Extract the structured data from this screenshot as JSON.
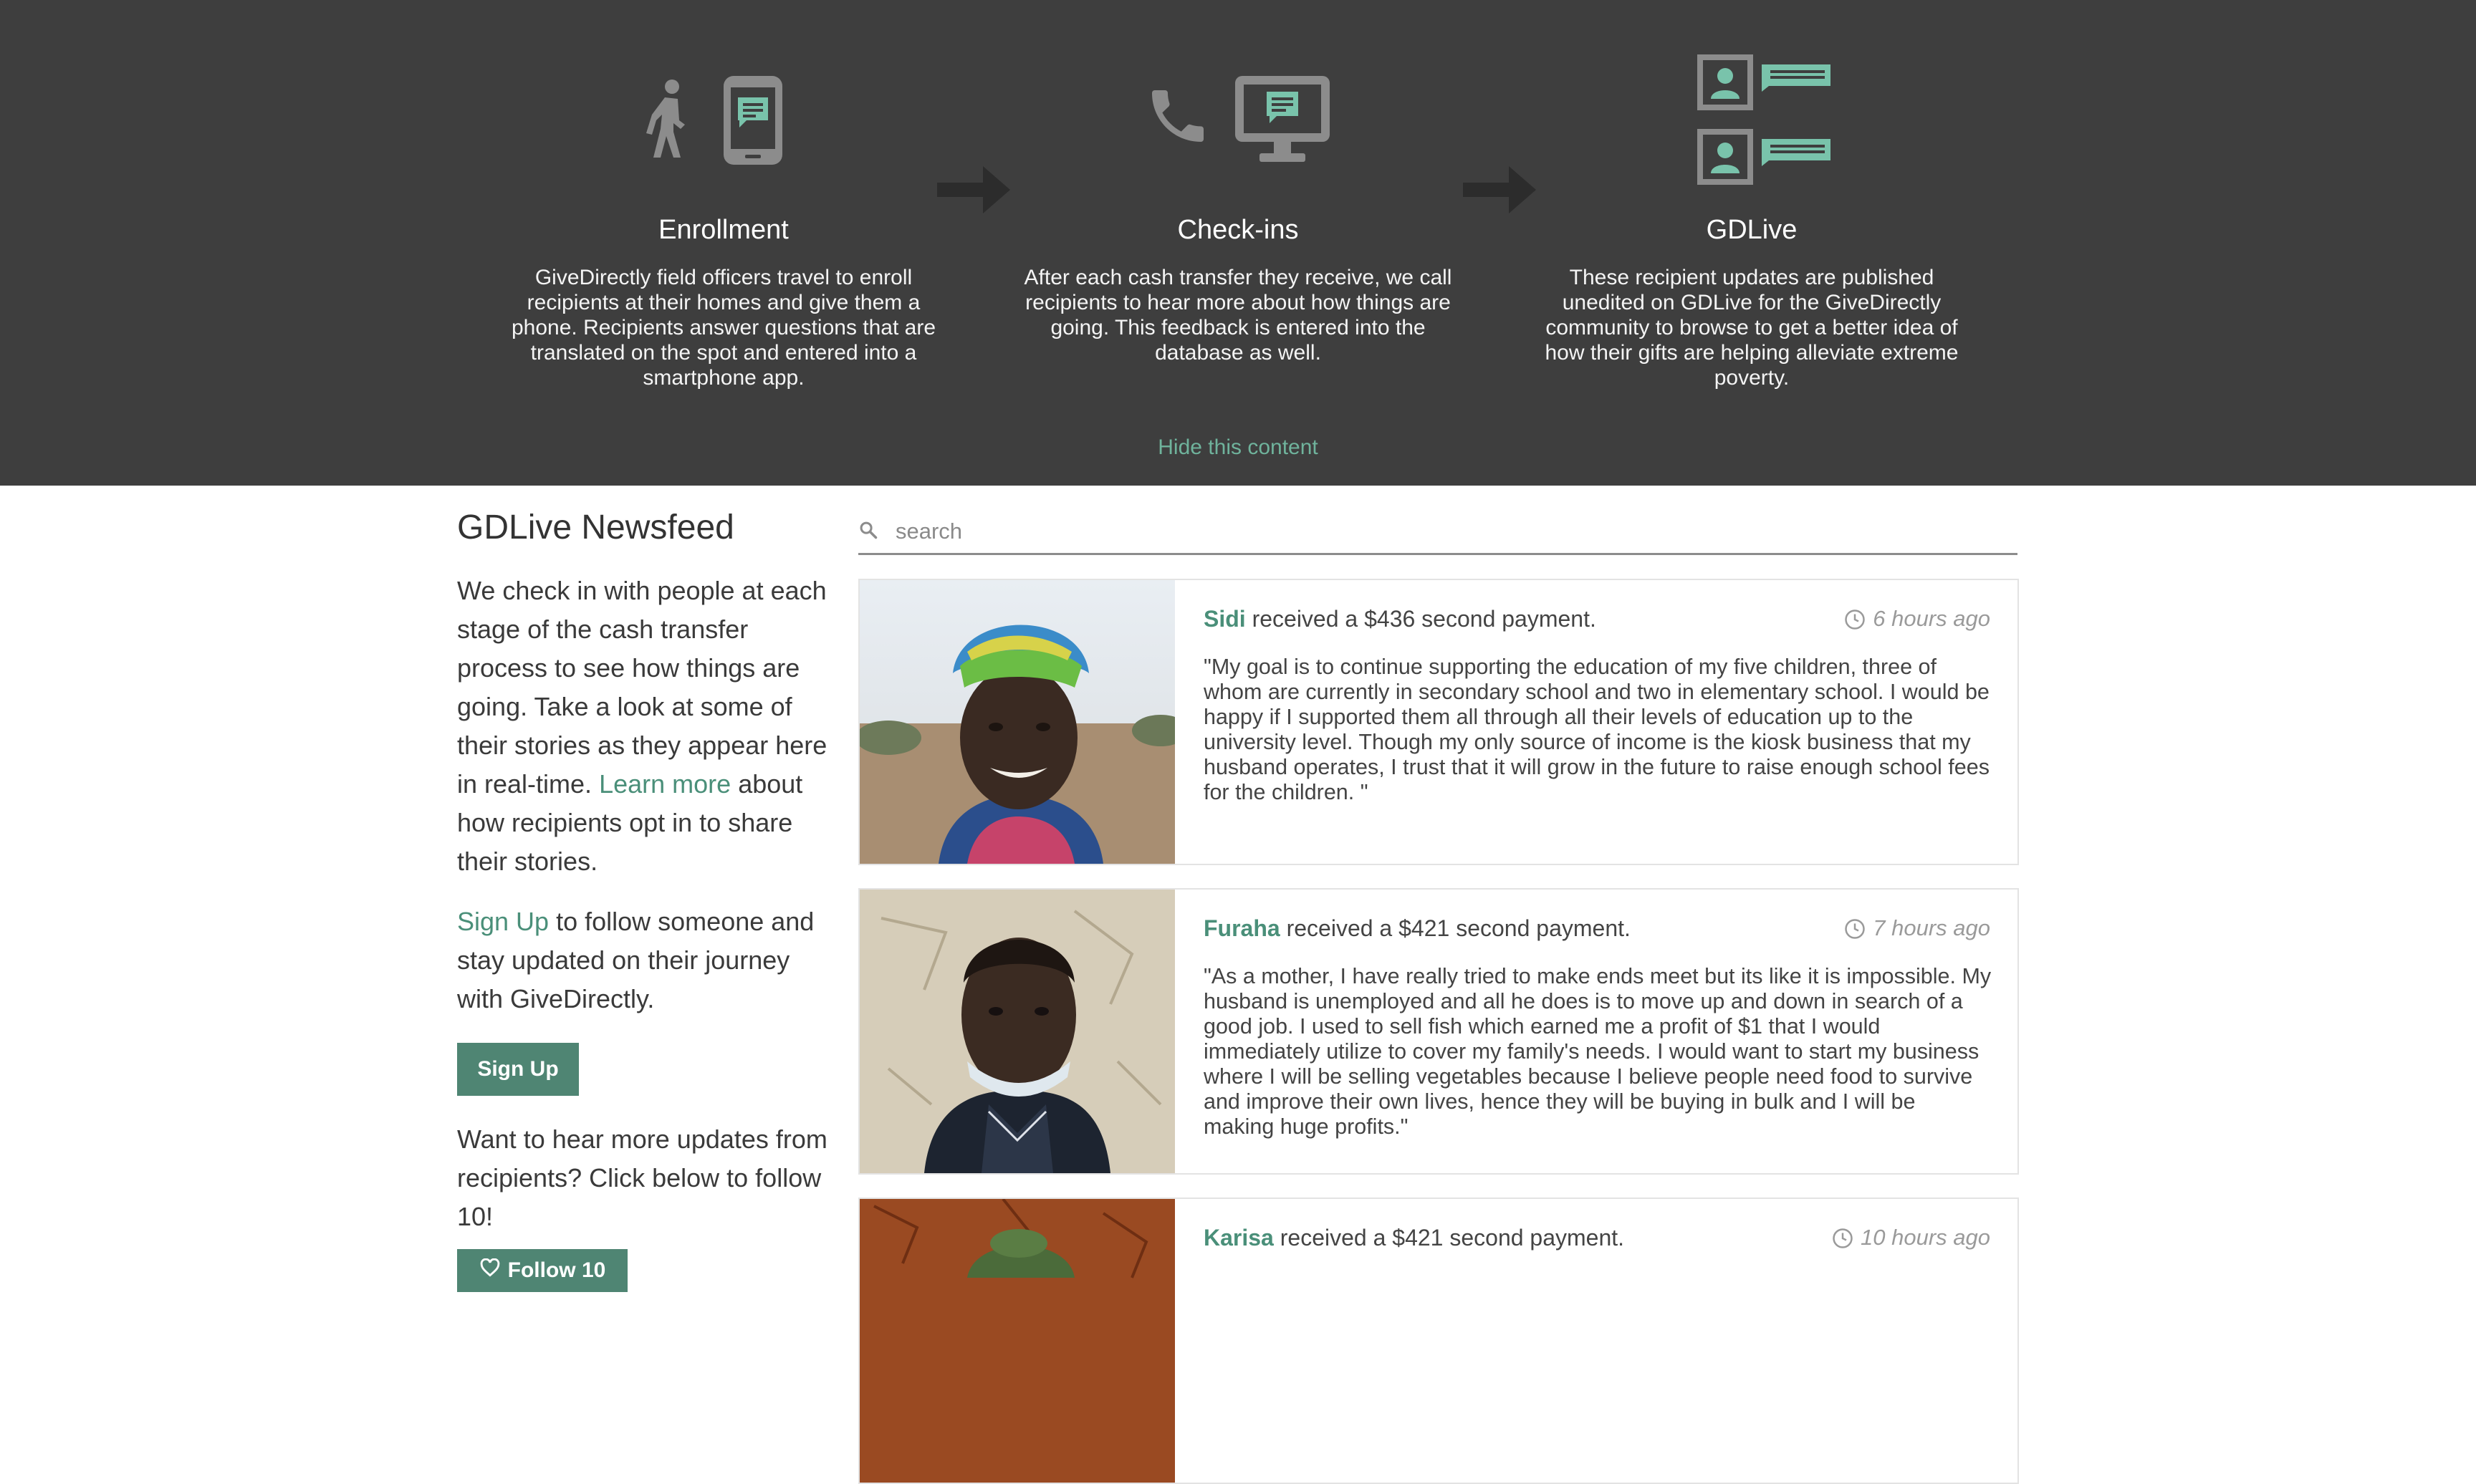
{
  "banner": {
    "steps": [
      {
        "title": "Enrollment",
        "description": "GiveDirectly field officers travel to enroll recipients at their homes and give them a phone. Recipients answer questions that are translated on the spot and entered into a smartphone app."
      },
      {
        "title": "Check-ins",
        "description": "After each cash transfer they receive, we call recipients to hear more about how things are going. This feedback is entered into the database as well."
      },
      {
        "title": "GDLive",
        "description": "These recipient updates are published unedited on GDLive for the GiveDirectly community to browse to get a better idea of how their gifts are helping alleviate extreme poverty."
      }
    ],
    "hide_label": "Hide this content"
  },
  "sidebar": {
    "title": "GDLive Newsfeed",
    "intro_before": "We check in with people at each stage of the cash transfer process to see how things are going. Take a look at some of their stories as they appear here in real-time.",
    "learn_more": "Learn more",
    "intro_after": "about how recipients opt in to share their stories.",
    "signup_link": "Sign Up",
    "signup_text": "to follow someone and stay updated on their journey with GiveDirectly.",
    "signup_button": "Sign Up",
    "follow_prompt": "Want to hear more updates from recipients? Click below to follow 10!",
    "follow_button": "Follow 10"
  },
  "search": {
    "placeholder": "search"
  },
  "feed": [
    {
      "name": "Sidi",
      "action": "received a $436 second payment.",
      "time": "6 hours ago",
      "quote": "\"My goal is to continue supporting the education of my five children, three of whom are currently in secondary school and two in elementary school. I would be happy if I supported them all through all their levels of education up to the university level. Though my only source of income is the kiosk business that my husband operates, I trust that it will grow in the future to raise enough school fees for the children. \""
    },
    {
      "name": "Furaha",
      "action": "received a $421 second payment.",
      "time": "7 hours ago",
      "quote": "\"As a mother, I have really tried to make ends meet but its like it is impossible. My husband is unemployed and all he does is to move up and down in search of a good job. I used to sell fish which earned me a profit of $1 that I would immediately utilize to cover my family's needs. I would want to start my business where I will be selling vegetables because I believe people need food to survive and improve their own lives, hence they will be buying in bulk and I will be making huge profits.\""
    },
    {
      "name": "Karisa",
      "action": "received a $421 second payment.",
      "time": "10 hours ago",
      "quote": ""
    }
  ],
  "colors": {
    "banner_bg": "#3e3e3e",
    "accent": "#6fb39c",
    "link": "#4a8f79",
    "button": "#4f8573"
  }
}
